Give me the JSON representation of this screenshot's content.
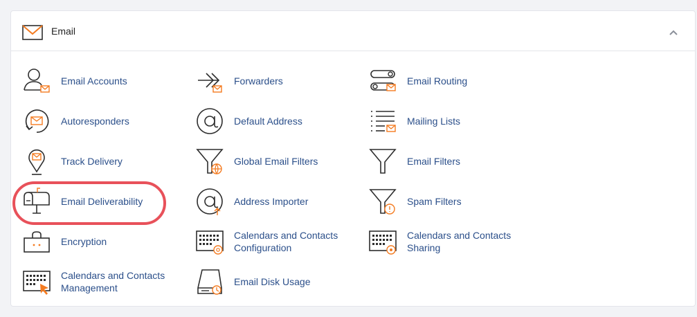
{
  "section": {
    "title": "Email",
    "icon": "envelope-icon",
    "collapse_icon": "chevron-up-icon"
  },
  "colors": {
    "link": "#2b4f8a",
    "accent": "#f47b20",
    "highlight": "#e8515a",
    "icon_stroke": "#2d2d2d"
  },
  "tools": [
    {
      "label": "Email Accounts",
      "icon": "user-mail-icon"
    },
    {
      "label": "Forwarders",
      "icon": "forward-mail-icon"
    },
    {
      "label": "Email Routing",
      "icon": "routing-mail-icon"
    },
    {
      "label": "Autoresponders",
      "icon": "autoresponder-icon"
    },
    {
      "label": "Default Address",
      "icon": "at-sign-icon"
    },
    {
      "label": "Mailing Lists",
      "icon": "list-mail-icon"
    },
    {
      "label": "Track Delivery",
      "icon": "location-pin-mail-icon"
    },
    {
      "label": "Global Email Filters",
      "icon": "funnel-globe-icon"
    },
    {
      "label": "Email Filters",
      "icon": "funnel-icon"
    },
    {
      "label": "Email Deliverability",
      "icon": "mailbox-icon"
    },
    {
      "label": "Address Importer",
      "icon": "at-import-icon"
    },
    {
      "label": "Spam Filters",
      "icon": "funnel-warning-icon"
    },
    {
      "label": "Encryption",
      "icon": "encrypted-box-icon"
    },
    {
      "label": "Calendars and Contacts\nConfiguration",
      "icon": "calendar-at-icon"
    },
    {
      "label": "Calendars and Contacts\nSharing",
      "icon": "calendar-share-icon"
    },
    {
      "label": "Calendars and Contacts\nManagement",
      "icon": "calendar-cursor-icon"
    },
    {
      "label": "Email Disk Usage",
      "icon": "disk-usage-icon"
    }
  ]
}
